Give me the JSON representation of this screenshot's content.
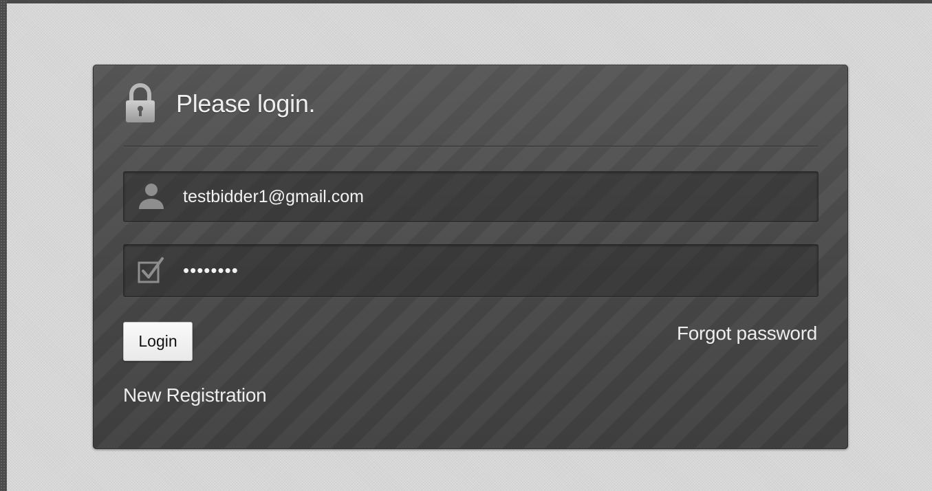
{
  "login_panel": {
    "title": "Please login.",
    "email_field": {
      "value": "testbidder1@gmail.com",
      "placeholder": ""
    },
    "password_field": {
      "value": "testpass",
      "placeholder": ""
    },
    "login_button_label": "Login",
    "forgot_password_label": "Forgot password",
    "new_registration_label": "New Registration"
  },
  "icons": {
    "header": "lock-icon",
    "email": "user-icon",
    "password": "checkbox-icon"
  },
  "colors": {
    "page_background": "#d6d6d6",
    "panel_background": "#464646",
    "text": "#efefef",
    "button_background": "#f2f2f2"
  }
}
